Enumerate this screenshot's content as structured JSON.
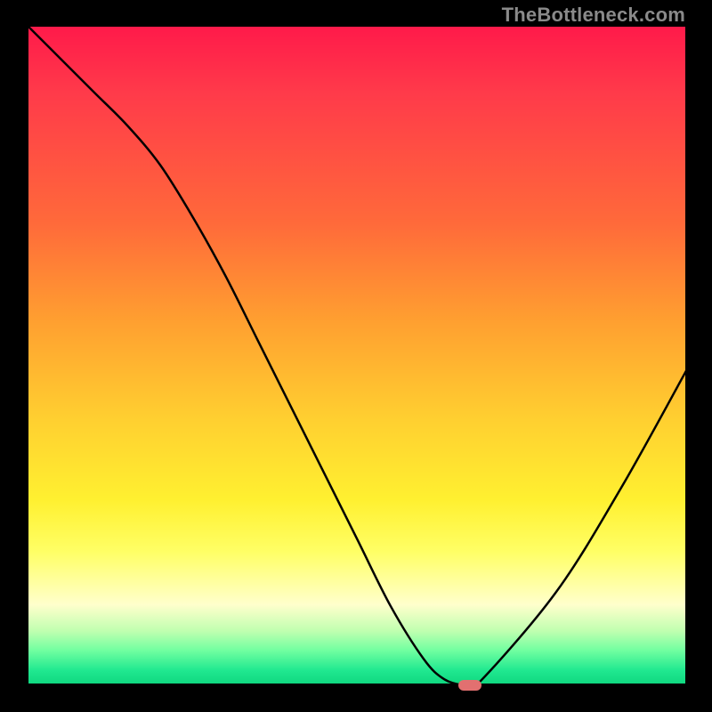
{
  "watermark": "TheBottleneck.com",
  "colors": {
    "gradient_top": "#ff1a4a",
    "gradient_bottom": "#10d880",
    "curve": "#000000",
    "marker": "#e27070",
    "background": "#000000"
  },
  "chart_data": {
    "type": "line",
    "title": "",
    "xlabel": "",
    "ylabel": "",
    "xlim": [
      0,
      100
    ],
    "ylim": [
      0,
      100
    ],
    "grid": false,
    "x": [
      0,
      5,
      10,
      15,
      20,
      25,
      30,
      35,
      40,
      45,
      50,
      55,
      60,
      63,
      66,
      68,
      80,
      90,
      100
    ],
    "values": [
      100,
      95,
      90,
      85,
      79,
      71,
      62,
      52,
      42,
      32,
      22,
      12,
      4,
      1,
      0,
      0,
      14,
      30,
      48
    ],
    "marker": {
      "x": 67,
      "y": 0
    },
    "annotations": []
  }
}
